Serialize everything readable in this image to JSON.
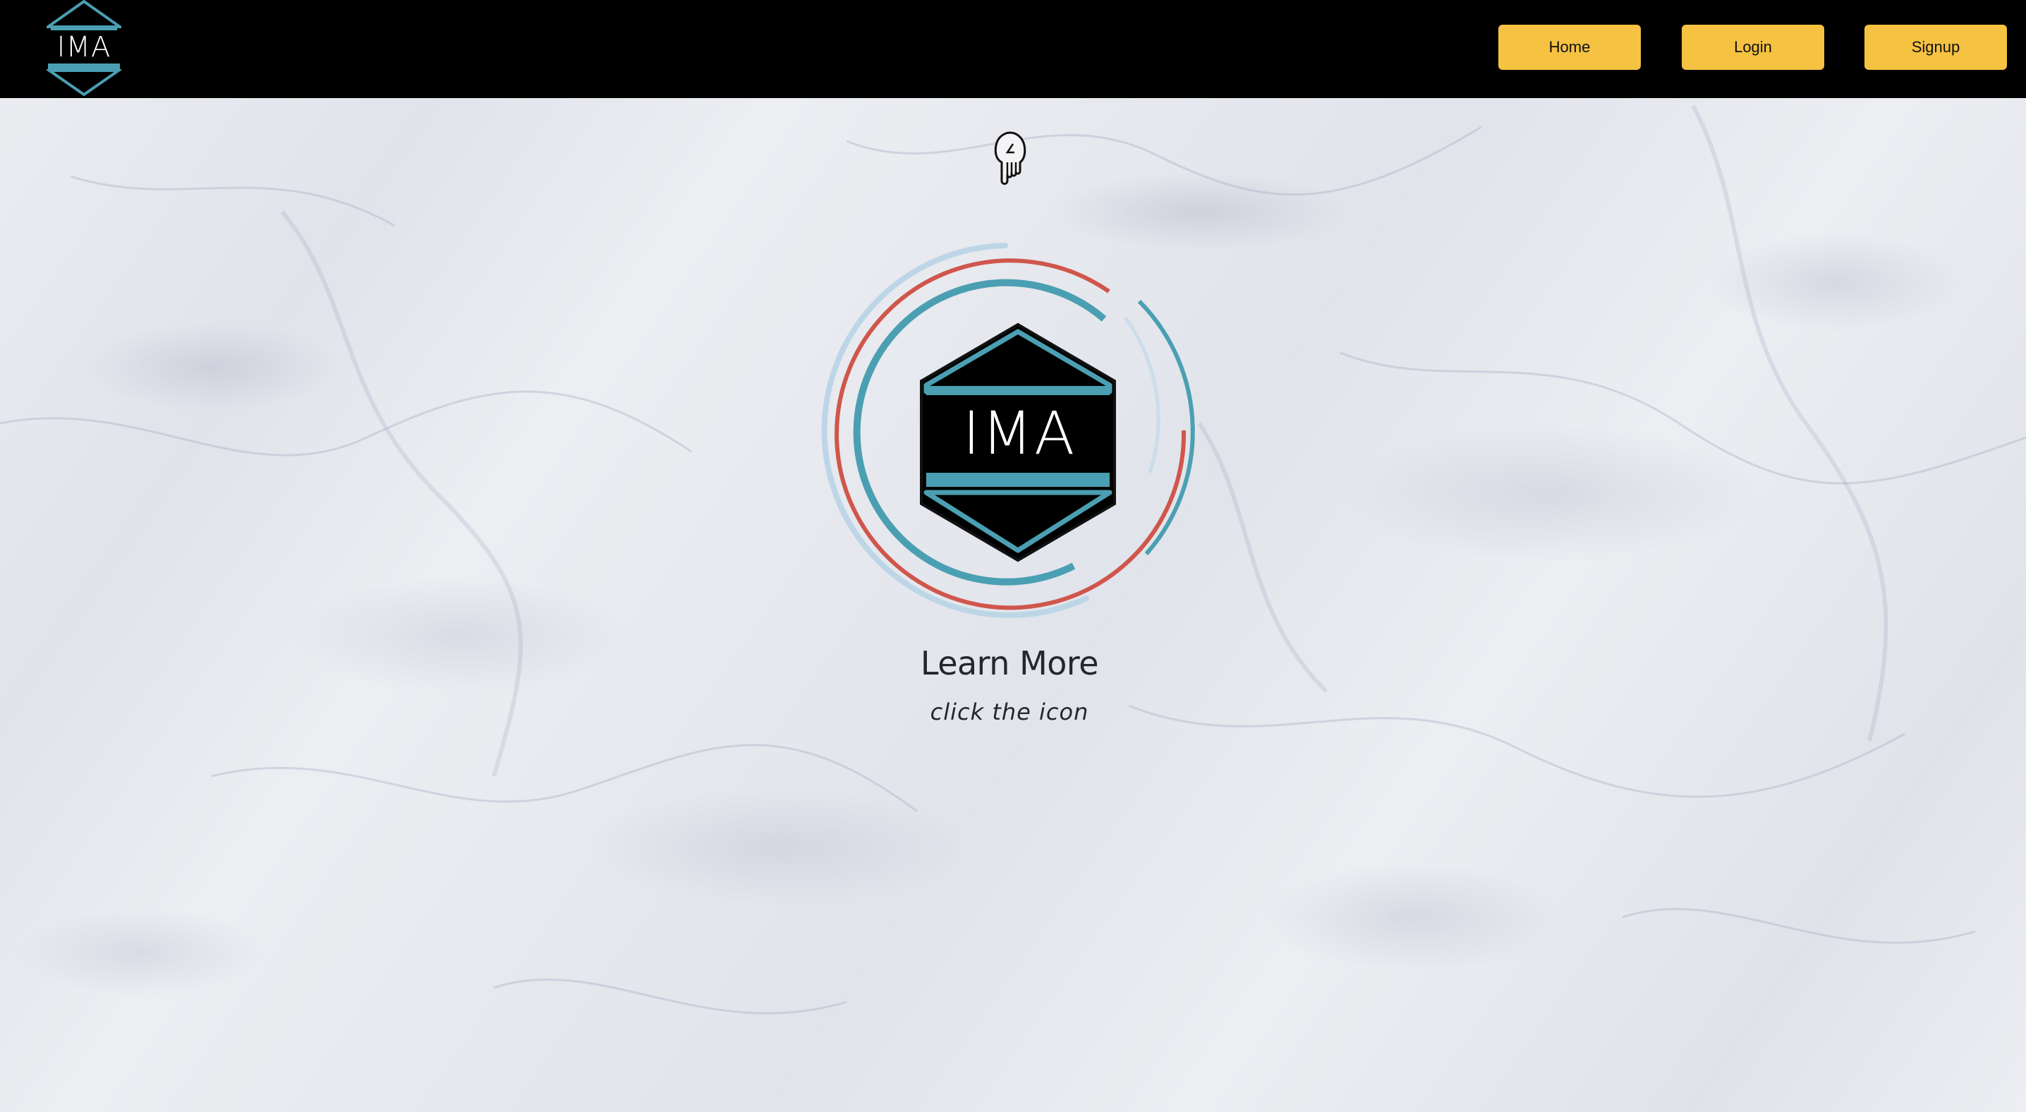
{
  "header": {
    "logo_text": "IMA",
    "nav": {
      "home_label": "Home",
      "login_label": "Login",
      "signup_label": "Signup"
    }
  },
  "main": {
    "pointer_icon": "hand-pointing-down-icon",
    "emblem_text": "IMA",
    "heading": "Learn More",
    "hint": "click the icon"
  },
  "colors": {
    "navbar_bg": "#000000",
    "button_bg": "#f5c242",
    "teal_accent": "#4b9fb2",
    "red_accent": "#d0564c",
    "light_blue_ring": "#b8d4e6"
  }
}
